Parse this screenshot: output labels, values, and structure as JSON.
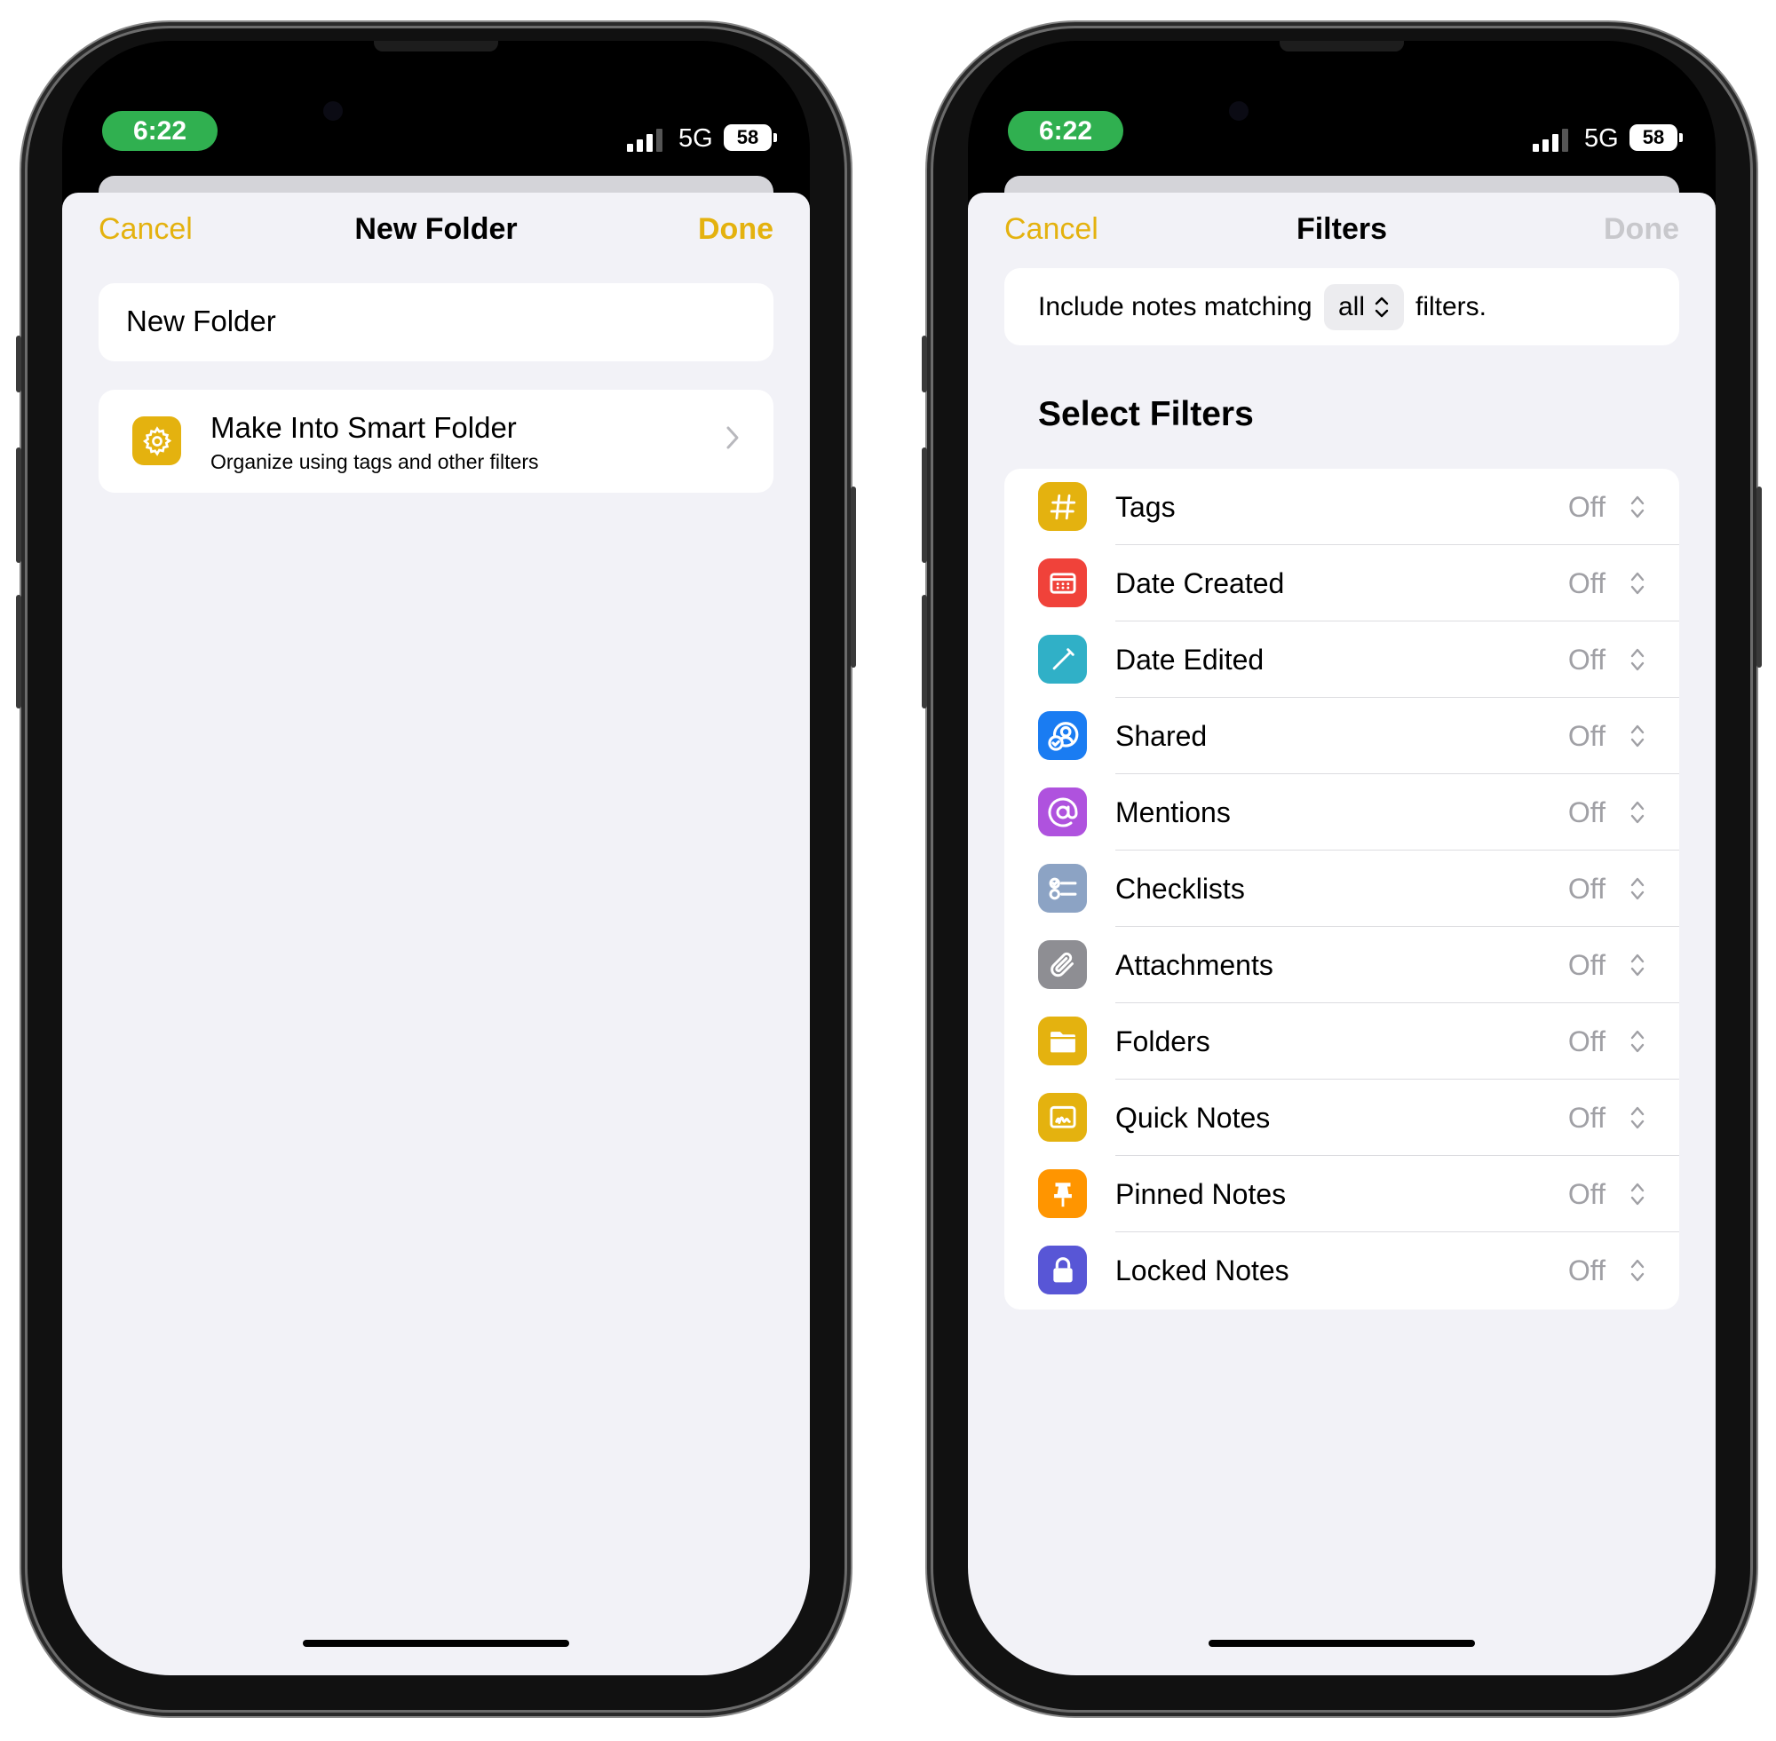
{
  "status_bar": {
    "time": "6:22",
    "network": "5G",
    "battery": "58"
  },
  "new_folder_screen": {
    "nav": {
      "cancel": "Cancel",
      "title": "New Folder",
      "done": "Done"
    },
    "name_field_value": "New Folder",
    "smart_folder": {
      "title": "Make Into Smart Folder",
      "subtitle": "Organize using tags and other filters",
      "icon": "gear-icon"
    }
  },
  "filters_screen": {
    "nav": {
      "cancel": "Cancel",
      "title": "Filters",
      "done": "Done",
      "done_enabled": false
    },
    "match": {
      "prefix": "Include notes matching",
      "selected": "all",
      "suffix": "filters."
    },
    "section_title": "Select Filters",
    "filters": [
      {
        "label": "Tags",
        "value": "Off",
        "icon": "hashtag-icon",
        "color": "#E4B20F"
      },
      {
        "label": "Date Created",
        "value": "Off",
        "icon": "calendar-icon",
        "color": "#F0423A"
      },
      {
        "label": "Date Edited",
        "value": "Off",
        "icon": "pencil-icon",
        "color": "#30B0C7"
      },
      {
        "label": "Shared",
        "value": "Off",
        "icon": "shared-person-icon",
        "color": "#1A7CF2"
      },
      {
        "label": "Mentions",
        "value": "Off",
        "icon": "at-sign-icon",
        "color": "#AF52DE"
      },
      {
        "label": "Checklists",
        "value": "Off",
        "icon": "checklist-icon",
        "color": "#8CA3C4"
      },
      {
        "label": "Attachments",
        "value": "Off",
        "icon": "paperclip-icon",
        "color": "#8E8E93"
      },
      {
        "label": "Folders",
        "value": "Off",
        "icon": "folder-icon",
        "color": "#E4B20F"
      },
      {
        "label": "Quick Notes",
        "value": "Off",
        "icon": "quick-note-icon",
        "color": "#E4B20F"
      },
      {
        "label": "Pinned Notes",
        "value": "Off",
        "icon": "pin-icon",
        "color": "#FF9500"
      },
      {
        "label": "Locked Notes",
        "value": "Off",
        "icon": "lock-icon",
        "color": "#5856D6"
      }
    ]
  },
  "colors": {
    "accent": "#E4B20F",
    "background": "#F2F2F7",
    "time_pill": "#30B050"
  }
}
